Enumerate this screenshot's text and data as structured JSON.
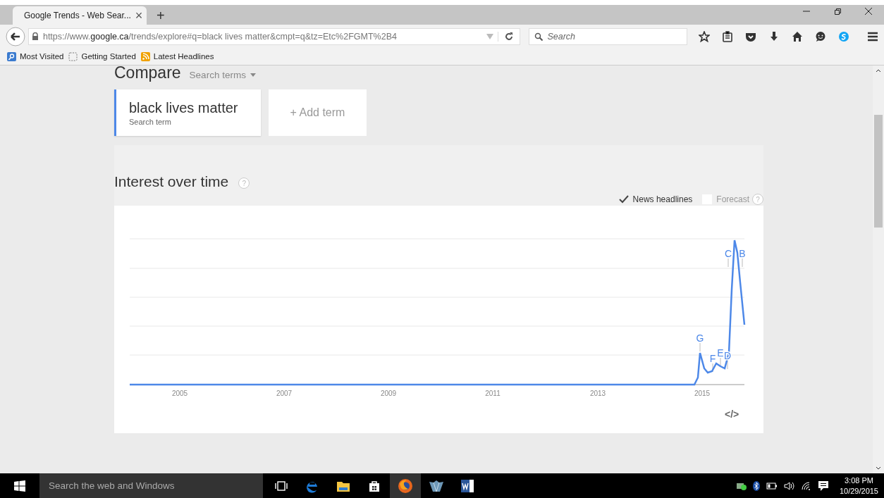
{
  "browser": {
    "tab_title": "Google Trends - Web Sear...",
    "tab_close": "×",
    "new_tab": "+",
    "url": "https://www.**google.ca**/trends/explore#q=black lives matter&cmpt=q&tz=Etc%2FGMT%2B4",
    "search_placeholder": "Search"
  },
  "bookmarks": [
    {
      "label": "Most Visited"
    },
    {
      "label": "Getting Started"
    },
    {
      "label": "Latest Headlines"
    }
  ],
  "compare": {
    "title": "Compare",
    "dropdown": "Search terms"
  },
  "terms": [
    {
      "term": "black lives matter",
      "sublabel": "Search term"
    }
  ],
  "add_term": "+ Add term",
  "section_title": "Interest over time",
  "help": "?",
  "options": [
    {
      "label": "News headlines",
      "checked": true,
      "disabled": false
    },
    {
      "label": "Forecast",
      "checked": false,
      "disabled": true
    }
  ],
  "chart": {
    "x_labels": [
      "2005",
      "2007",
      "2009",
      "2011",
      "2013",
      "2015"
    ],
    "markers": [
      "G",
      "F",
      "E",
      "D",
      "C",
      "B"
    ],
    "embed": "</>"
  },
  "taskbar": {
    "search_placeholder": "Search the web and Windows",
    "apps": [
      {
        "kind": "taskview",
        "selected": false
      },
      {
        "kind": "edge",
        "selected": false
      },
      {
        "kind": "explorer",
        "selected": false
      },
      {
        "kind": "store",
        "selected": false
      },
      {
        "kind": "firefox",
        "selected": true
      },
      {
        "kind": "app",
        "selected": false
      },
      {
        "kind": "word",
        "selected": false
      }
    ],
    "time": "3:08 PM",
    "date": "10/29/2015"
  }
}
